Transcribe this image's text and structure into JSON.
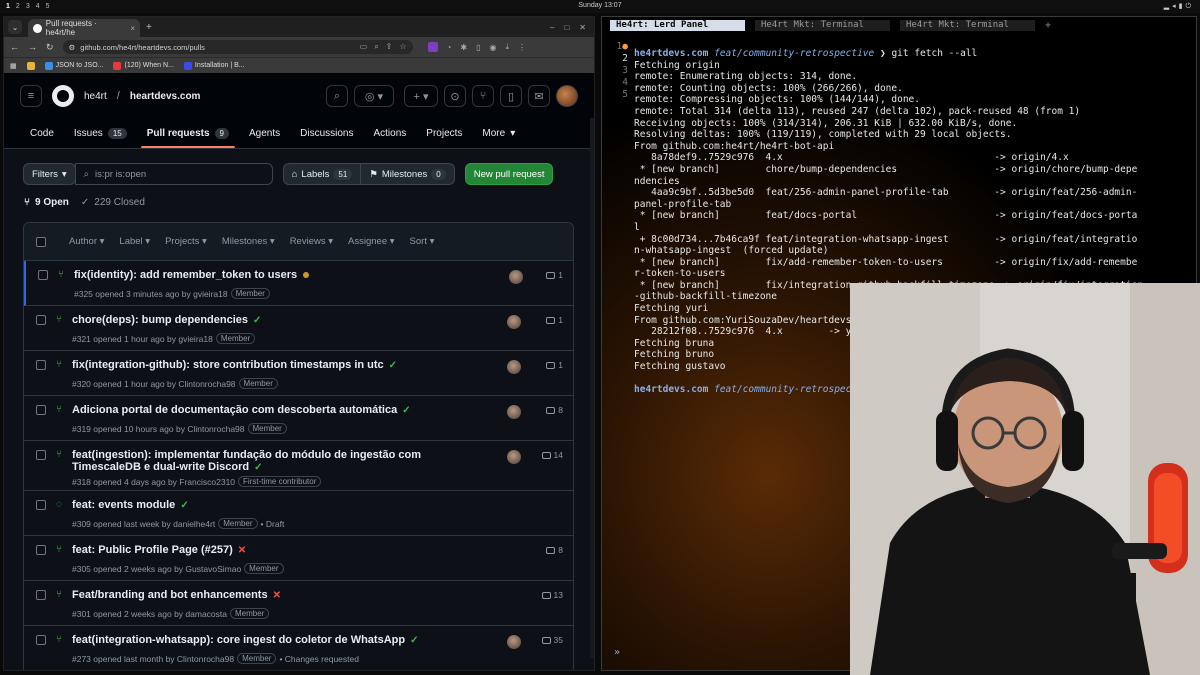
{
  "system": {
    "workspaces": [
      "1",
      "2",
      "3",
      "4",
      "5"
    ],
    "clock": "Sunday 13:07"
  },
  "chrome": {
    "tab_title": "Pull requests · he4rt/he",
    "url": "github.com/he4rt/heartdevs.com/pulls",
    "bookmarks": [
      "JSON to JSO...",
      "(120) When N...",
      "Installation | B..."
    ]
  },
  "github": {
    "owner": "he4rt",
    "repo": "heartdevs.com",
    "nav": [
      {
        "label": "Code",
        "count": ""
      },
      {
        "label": "Issues",
        "count": "15"
      },
      {
        "label": "Pull requests",
        "count": "9"
      },
      {
        "label": "Agents",
        "count": ""
      },
      {
        "label": "Discussions",
        "count": ""
      },
      {
        "label": "Actions",
        "count": ""
      },
      {
        "label": "Projects",
        "count": ""
      },
      {
        "label": "More",
        "count": ""
      }
    ],
    "filters_label": "Filters",
    "search_value": "is:pr is:open",
    "labels_label": "Labels",
    "labels_count": "51",
    "milestones_label": "Milestones",
    "milestones_count": "0",
    "new_pr_label": "New pull request",
    "open_label": "9 Open",
    "closed_label": "229 Closed",
    "list_filters": [
      "Author",
      "Label",
      "Projects",
      "Milestones",
      "Reviews",
      "Assignee",
      "Sort"
    ],
    "prs": [
      {
        "title": "fix(identity): add remember_token to users",
        "status": "pending",
        "meta": "#325 opened 3 minutes ago by gvieira18",
        "label": "Member",
        "extra": "",
        "comments": "1",
        "avatar": true
      },
      {
        "title": "chore(deps): bump dependencies",
        "status": "ok",
        "meta": "#321 opened 1 hour ago by gvieira18",
        "label": "Member",
        "extra": "",
        "comments": "1",
        "avatar": true
      },
      {
        "title": "fix(integration-github): store contribution timestamps in utc",
        "status": "ok",
        "meta": "#320 opened 1 hour ago by Clintonrocha98",
        "label": "Member",
        "extra": "",
        "comments": "1",
        "avatar": true
      },
      {
        "title": "Adiciona portal de documentação com descoberta automática",
        "status": "ok",
        "meta": "#319 opened 10 hours ago by Clintonrocha98",
        "label": "Member",
        "extra": "",
        "comments": "8",
        "avatar": true
      },
      {
        "title": "feat(ingestion): implementar fundação do módulo de ingestão com",
        "title2": "TimescaleDB e dual-write Discord",
        "status": "ok",
        "meta": "#318 opened 4 days ago by Francisco2310",
        "label": "First-time contributor",
        "extra": "",
        "comments": "14",
        "avatar": true
      },
      {
        "title": "feat: events module",
        "status": "ok",
        "meta": "#309 opened last week by danielhe4rt",
        "label": "Member",
        "extra": "• Draft",
        "comments": "",
        "avatar": false
      },
      {
        "title": "feat: Public Profile Page (#257)",
        "status": "fail",
        "meta": "#305 opened 2 weeks ago by GustavoSimao",
        "label": "Member",
        "extra": "",
        "comments": "8",
        "avatar": false
      },
      {
        "title": "Feat/branding and bot enhancements",
        "status": "fail",
        "meta": "#301 opened 2 weeks ago by damacosta",
        "label": "Member",
        "extra": "",
        "comments": "13",
        "avatar": false
      },
      {
        "title": "feat(integration-whatsapp): core ingest do coletor de WhatsApp",
        "status": "ok",
        "meta": "#273 opened last month by Clintonrocha98",
        "label": "Member",
        "extra": "• Changes requested",
        "comments": "35",
        "avatar": true
      }
    ]
  },
  "terminal": {
    "tabs": [
      "He4rt: Lerd Panel",
      "He4rt Mkt: Terminal",
      "He4rt Mkt: Terminal"
    ],
    "gutter": [
      "1",
      "2",
      "3",
      "4",
      "5"
    ],
    "prompt_host": "he4rtdevs.com",
    "prompt_branch": "feat/community-retrospective",
    "prompt_arrow": "❯",
    "command": "git fetch --all",
    "output": [
      "Fetching origin",
      "remote: Enumerating objects: 314, done.",
      "remote: Counting objects: 100% (266/266), done.",
      "remote: Compressing objects: 100% (144/144), done.",
      "remote: Total 314 (delta 113), reused 247 (delta 102), pack-reused 48 (from 1)",
      "Receiving objects: 100% (314/314), 206.31 KiB | 632.00 KiB/s, done.",
      "Resolving deltas: 100% (119/119), completed with 29 local objects.",
      "From github.com:he4rt/he4rt-bot-api",
      "   8a78def9..7529c976  4.x                                     -> origin/4.x",
      " * [new branch]        chore/bump-dependencies                 -> origin/chore/bump-depe",
      "ndencies",
      "   4aa9c9bf..5d3be5d0  feat/256-admin-panel-profile-tab        -> origin/feat/256-admin-",
      "panel-profile-tab",
      " * [new branch]        feat/docs-portal                        -> origin/feat/docs-porta",
      "l",
      " + 8c00d734...7b46ca9f feat/integration-whatsapp-ingest        -> origin/feat/integratio",
      "n-whatsapp-ingest  (forced update)",
      " * [new branch]        fix/add-remember-token-to-users         -> origin/fix/add-remembe",
      "r-token-to-users",
      " * [new branch]        fix/integration-github-backfill-timezone -> origin/fix/integration",
      "-github-backfill-timezone",
      "Fetching yuri",
      "From github.com:YuriSouzaDev/heartdevs.com",
      "   28212f08..7529c976  4.x        -> yuri/4.x",
      "Fetching bruna",
      "Fetching bruno",
      "Fetching gustavo"
    ],
    "bottom_glyph": "»"
  }
}
